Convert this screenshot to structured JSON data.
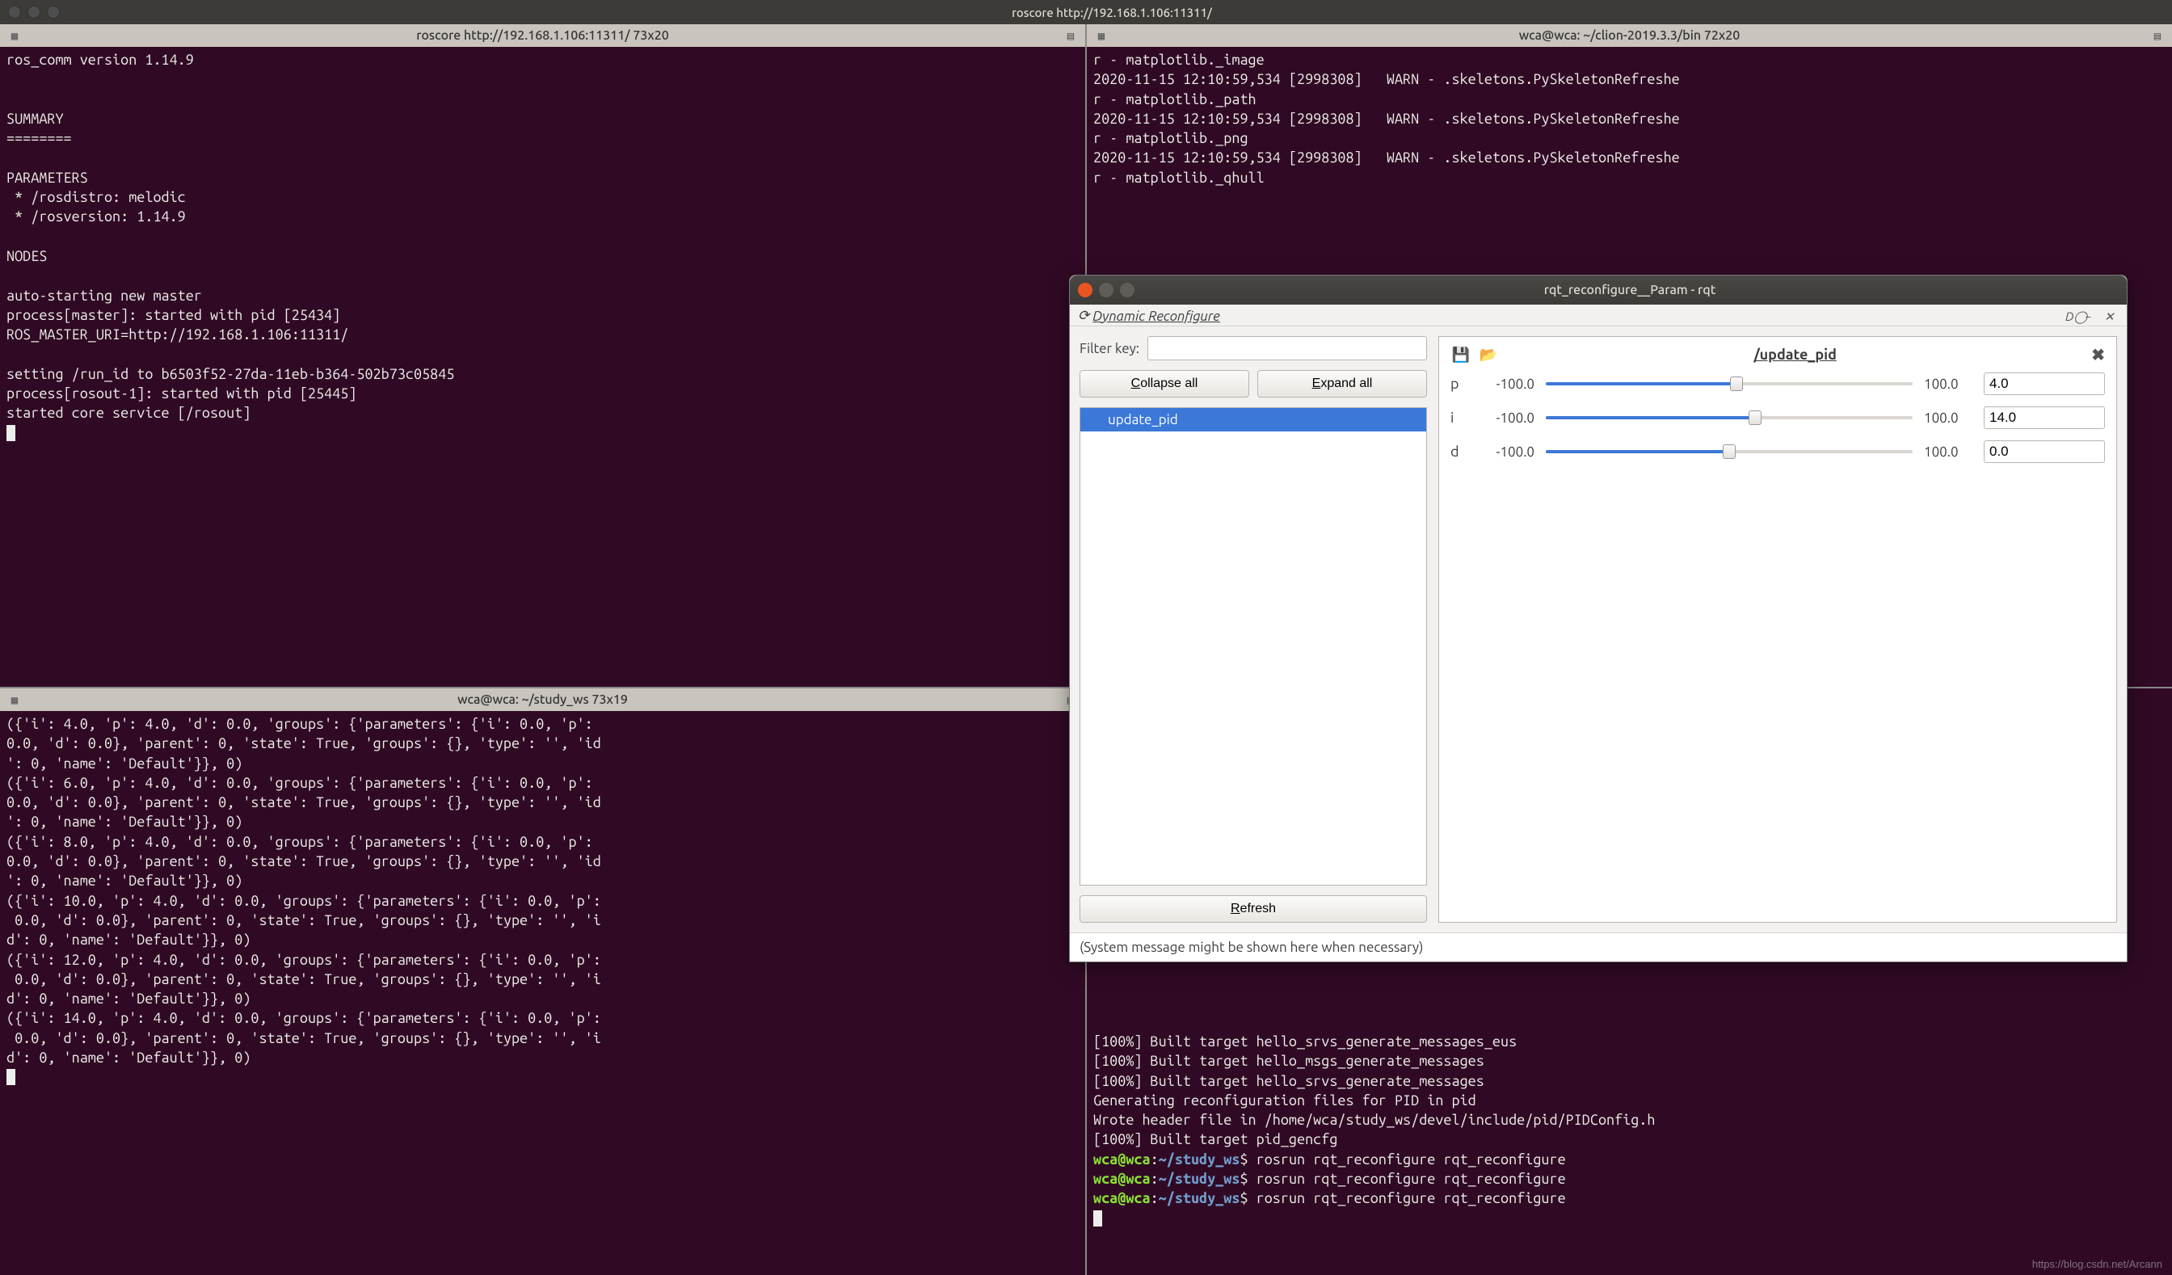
{
  "main_window": {
    "title": "roscore http://192.168.1.106:11311/"
  },
  "panes": {
    "top_left": {
      "title": "roscore http://192.168.1.106:11311/ 73x20",
      "lines": [
        "ros_comm version 1.14.9",
        "",
        "",
        "SUMMARY",
        "========",
        "",
        "PARAMETERS",
        " * /rosdistro: melodic",
        " * /rosversion: 1.14.9",
        "",
        "NODES",
        "",
        "auto-starting new master",
        "process[master]: started with pid [25434]",
        "ROS_MASTER_URI=http://192.168.1.106:11311/",
        "",
        "setting /run_id to b6503f52-27da-11eb-b364-502b73c05845",
        "process[rosout-1]: started with pid [25445]",
        "started core service [/rosout]"
      ]
    },
    "top_right": {
      "title": "wca@wca: ~/clion-2019.3.3/bin 72x20",
      "lines": [
        "r - matplotlib._image",
        "2020-11-15 12:10:59,534 [2998308]   WARN - .skeletons.PySkeletonRefreshe",
        "r - matplotlib._path",
        "2020-11-15 12:10:59,534 [2998308]   WARN - .skeletons.PySkeletonRefreshe",
        "r - matplotlib._png",
        "2020-11-15 12:10:59,534 [2998308]   WARN - .skeletons.PySkeletonRefreshe",
        "r - matplotlib._qhull"
      ],
      "build_lines": [
        "[100%] Built target hello_srvs_generate_messages_eus",
        "[100%] Built target hello_msgs_generate_messages",
        "[100%] Built target hello_srvs_generate_messages",
        "Generating reconfiguration files for PID in pid",
        "Wrote header file in /home/wca/study_ws/devel/include/pid/PIDConfig.h",
        "[100%] Built target pid_gencfg"
      ],
      "prompts": [
        {
          "user": "wca@wca",
          "path": "~/study_ws",
          "cmd": "rosrun rqt_reconfigure rqt_reconfigure"
        },
        {
          "user": "wca@wca",
          "path": "~/study_ws",
          "cmd": "rosrun rqt_reconfigure rqt_reconfigure"
        },
        {
          "user": "wca@wca",
          "path": "~/study_ws",
          "cmd": "rosrun rqt_reconfigure rqt_reconfigure"
        }
      ]
    },
    "bottom_left": {
      "title": "wca@wca: ~/study_ws 73x19",
      "lines": [
        "({'i': 4.0, 'p': 4.0, 'd': 0.0, 'groups': {'parameters': {'i': 0.0, 'p':",
        "0.0, 'd': 0.0}, 'parent': 0, 'state': True, 'groups': {}, 'type': '', 'id",
        "': 0, 'name': 'Default'}}, 0)",
        "({'i': 6.0, 'p': 4.0, 'd': 0.0, 'groups': {'parameters': {'i': 0.0, 'p':",
        "0.0, 'd': 0.0}, 'parent': 0, 'state': True, 'groups': {}, 'type': '', 'id",
        "': 0, 'name': 'Default'}}, 0)",
        "({'i': 8.0, 'p': 4.0, 'd': 0.0, 'groups': {'parameters': {'i': 0.0, 'p':",
        "0.0, 'd': 0.0}, 'parent': 0, 'state': True, 'groups': {}, 'type': '', 'id",
        "': 0, 'name': 'Default'}}, 0)",
        "({'i': 10.0, 'p': 4.0, 'd': 0.0, 'groups': {'parameters': {'i': 0.0, 'p':",
        " 0.0, 'd': 0.0}, 'parent': 0, 'state': True, 'groups': {}, 'type': '', 'i",
        "d': 0, 'name': 'Default'}}, 0)",
        "({'i': 12.0, 'p': 4.0, 'd': 0.0, 'groups': {'parameters': {'i': 0.0, 'p':",
        " 0.0, 'd': 0.0}, 'parent': 0, 'state': True, 'groups': {}, 'type': '', 'i",
        "d': 0, 'name': 'Default'}}, 0)",
        "({'i': 14.0, 'p': 4.0, 'd': 0.0, 'groups': {'parameters': {'i': 0.0, 'p':",
        " 0.0, 'd': 0.0}, 'parent': 0, 'state': True, 'groups': {}, 'type': '', 'i",
        "d': 0, 'name': 'Default'}}, 0)"
      ]
    }
  },
  "rqt": {
    "title": "rqt_reconfigure__Param - rqt",
    "dock_title": "Dynamic Reconfigure",
    "filter_label": "Filter key:",
    "collapse_label": "Collapse all",
    "expand_label": "Expand all",
    "refresh_label": "Refresh",
    "tree": [
      {
        "name": "update_pid",
        "selected": true
      }
    ],
    "node_name": "/update_pid",
    "params": [
      {
        "name": "p",
        "min": "-100.0",
        "max": "100.0",
        "value": "4.0",
        "fill_pct": 52
      },
      {
        "name": "i",
        "min": "-100.0",
        "max": "100.0",
        "value": "14.0",
        "fill_pct": 57
      },
      {
        "name": "d",
        "min": "-100.0",
        "max": "100.0",
        "value": "0.0",
        "fill_pct": 50
      }
    ],
    "sys_msg": "(System message might be shown here when necessary)"
  },
  "watermark": "https://blog.csdn.net/Arcann"
}
